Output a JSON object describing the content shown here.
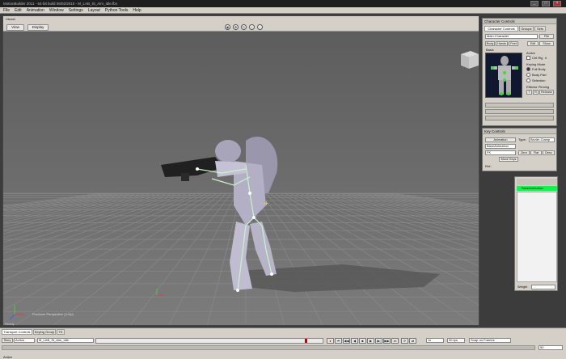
{
  "app": {
    "title": "MotionBuilder 2011 - 64-bit build 06/02/2010 - M_LAB_St_Aim_Idle.fbx",
    "window_controls": [
      "_",
      "□",
      "×"
    ]
  },
  "menu": [
    "File",
    "Edit",
    "Animation",
    "Window",
    "Settings",
    "Layout",
    "Python Tools",
    "Help"
  ],
  "viewer": {
    "title": "Viewer",
    "buttons": {
      "view": "View",
      "display": "Display"
    },
    "nav_icons": [
      "look-icon",
      "pan-icon",
      "orbit-icon",
      "zoom-icon",
      "zoom-out-icon"
    ],
    "camera_label": "Producer Perspective (Y-Up)",
    "status": "Ready"
  },
  "character_controls": {
    "title": "Character Controls",
    "tabs": [
      "Character Controls",
      "Groups",
      "Sets"
    ],
    "character": "Main:Character",
    "file_label": "File",
    "subtabs": [
      "Body",
      "Hands",
      "Feet",
      "Edit",
      "Show"
    ],
    "section_label": "Basic",
    "active_label": "Active",
    "ctrl_rig_label": "Ctrl Rig",
    "ctrl_rig_value": "Ir",
    "keying_mode_label": "Keying Mode",
    "keying_modes": [
      "Full Body",
      "Body Part",
      "Selection"
    ],
    "effector_pinning_label": "Effector Pinning",
    "pin_buttons": [
      "T",
      "R",
      "Release"
    ]
  },
  "key_controls": {
    "title": "Key Controls",
    "animation_button": "Animation",
    "type_label": "Type:",
    "type_value": "Bezier-Clamp",
    "layer": "BaseAnimation",
    "fk_value": "FK",
    "buttons": [
      "Zero",
      "Flat",
      "Desc"
    ],
    "move_keys": "Move Keys",
    "ref_label": "Ref.:"
  },
  "layers": {
    "base_layer": "BaseAnimation",
    "weight_label": "Weight",
    "accent": "#00ff44"
  },
  "transport": {
    "title": "Transport Controls",
    "tab2": "Keying Group",
    "tab3": "TK",
    "story_label": "Story",
    "action_label": "Action",
    "take": "M_LAB_St_Aim_Idle",
    "speed": "1x",
    "fps": "30 fps",
    "snap": "Snap on Frames",
    "bottom_label": "Action",
    "end_frame": "50"
  }
}
